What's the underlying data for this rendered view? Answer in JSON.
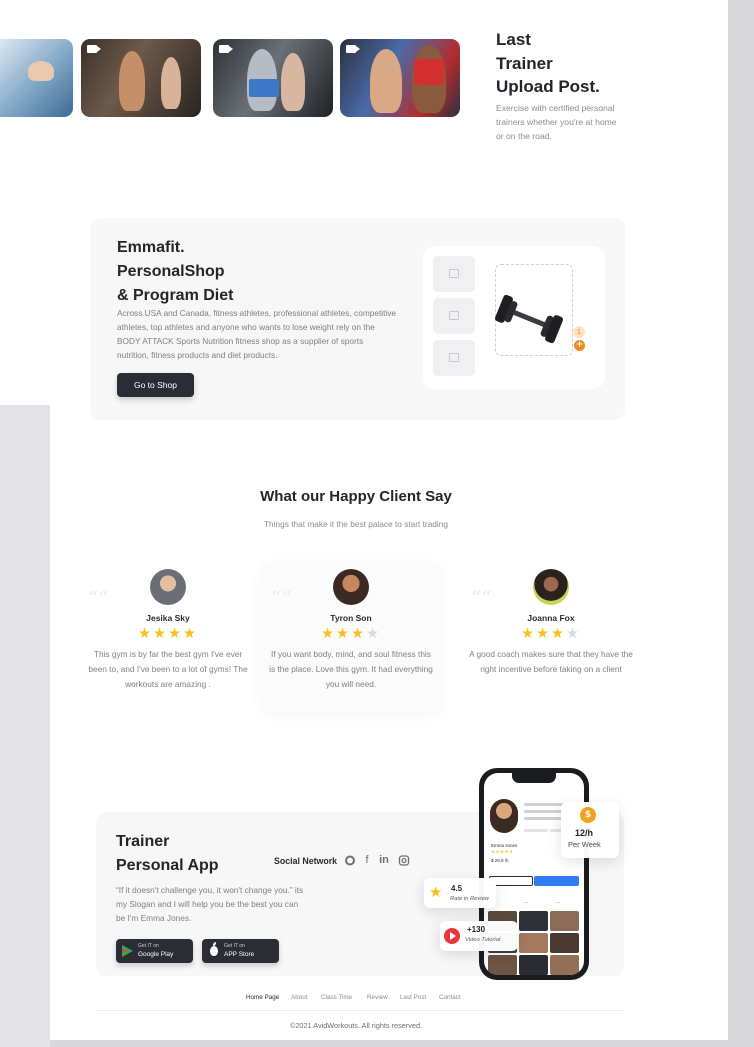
{
  "trainer": {
    "title_line1": "Last",
    "title_line2": "Trainer",
    "title_line3": "Upload Post.",
    "description": "Exercise with certified personal trainers whether you're at home or on the road."
  },
  "shop": {
    "title_line1": "Emmafit.",
    "title_line2": "PersonalShop",
    "title_line3": "& Program Diet",
    "description": "Across USA and Canada, fitness athletes, professional athletes, competitive athletes, top athletes and anyone who wants to lose weight rely on the BODY ATTACK Sports Nutrition fitness shop as a supplier of sports nutrition, fitness products and diet products.",
    "button_label": "Go to Shop",
    "cart_count": "1",
    "plus": "+"
  },
  "testimonials": {
    "title": "What our Happy Client Say",
    "subtitle": "Things that make it the best palace to start trading",
    "quote_mark": "““",
    "items": [
      {
        "name": "Jesika Sky",
        "rating": 4,
        "text": "This gym is by far the best gym I've ever been to, and I've been to a lot of gyms! The workouts are amazing ."
      },
      {
        "name": "Tyron Son",
        "rating": 3,
        "text": "If you want body, mind, and soul fitness this is the place. Love this gym. It had everything you will need."
      },
      {
        "name": "Joanna Fox",
        "rating": 3,
        "text": "A good coach makes sure that they have the right incentive before taking on a client"
      }
    ]
  },
  "app": {
    "title_line1": "Trainer",
    "title_line2": "Personal App",
    "quote": "“If it doesn't challenge you, it won't change you.”  its my Slogan and I will help you be the best you can be I'm Emma Jones.",
    "social_label": "Social Network",
    "social_icons": [
      "whatsapp-icon",
      "facebook-icon",
      "linkedin-icon",
      "instagram-icon"
    ],
    "google_small": "Get IT on",
    "google_big": "Google Play",
    "apple_small": "Get IT on",
    "apple_big": "APP Store",
    "price_value": "12/h",
    "price_label": "Per Week",
    "rating_value": "4.5",
    "rating_label": "Rate in Review",
    "video_value": "+130",
    "video_label": "Video Tutorial",
    "phone_name": "Emma Jones",
    "phone_price": "$ 28.8 /h"
  },
  "footer": {
    "nav": [
      "Home Page",
      "About",
      "Class Time",
      "Review",
      "Last Post",
      "Contact"
    ],
    "copyright": "©2021 AvidWorkouts. All rights reserved."
  },
  "colors": {
    "accent": "#f5931e",
    "dark": "#2b2d34",
    "star": "#f8c21d",
    "blue": "#2f7cf6"
  }
}
